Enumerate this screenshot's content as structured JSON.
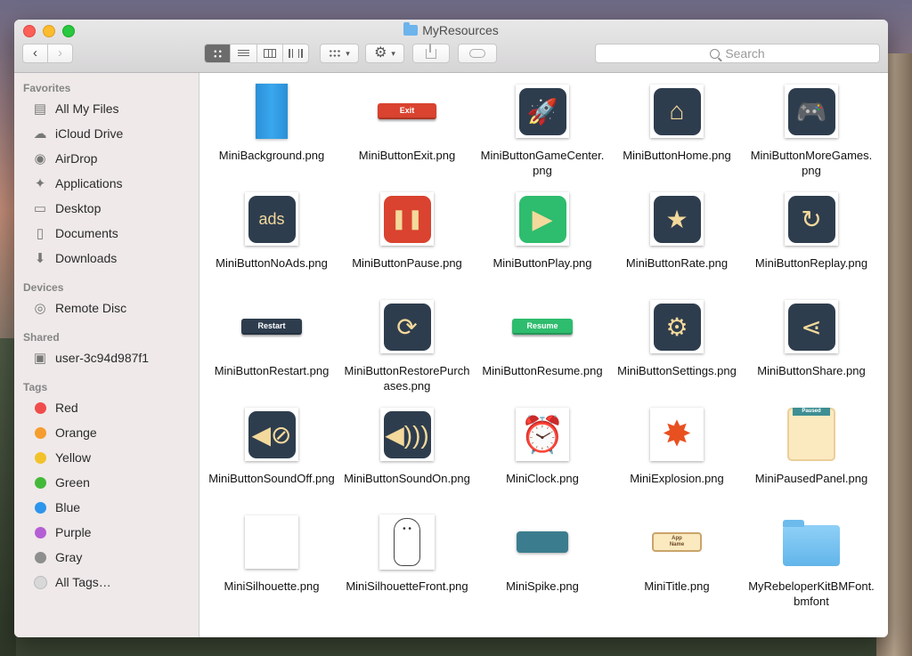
{
  "window": {
    "title": "MyResources"
  },
  "toolbar": {
    "search_placeholder": "Search",
    "back_icon": "chevron-left",
    "forward_icon": "chevron-right",
    "view_modes": [
      "icon",
      "list",
      "column",
      "cover-flow"
    ],
    "gear_glyph": "⚙",
    "chevron_glyph": "▾"
  },
  "sidebar": {
    "favorites_title": "Favorites",
    "favorites": [
      {
        "label": "All My Files",
        "icon": "all-files-icon",
        "glyph": "▤"
      },
      {
        "label": "iCloud Drive",
        "icon": "cloud-icon",
        "glyph": "☁"
      },
      {
        "label": "AirDrop",
        "icon": "airdrop-icon",
        "glyph": "◉"
      },
      {
        "label": "Applications",
        "icon": "applications-icon",
        "glyph": "✦"
      },
      {
        "label": "Desktop",
        "icon": "desktop-icon",
        "glyph": "▭"
      },
      {
        "label": "Documents",
        "icon": "documents-icon",
        "glyph": "▯"
      },
      {
        "label": "Downloads",
        "icon": "downloads-icon",
        "glyph": "⬇"
      }
    ],
    "devices_title": "Devices",
    "devices": [
      {
        "label": "Remote Disc",
        "icon": "disc-icon",
        "glyph": "◎"
      }
    ],
    "shared_title": "Shared",
    "shared": [
      {
        "label": "user-3c94d987f1",
        "icon": "computer-icon",
        "glyph": "▣"
      }
    ],
    "tags_title": "Tags",
    "tags": [
      {
        "label": "Red",
        "color": "#f14c4c"
      },
      {
        "label": "Orange",
        "color": "#f59d2e"
      },
      {
        "label": "Yellow",
        "color": "#f2c22b"
      },
      {
        "label": "Green",
        "color": "#43b93a"
      },
      {
        "label": "Blue",
        "color": "#2d95ec"
      },
      {
        "label": "Purple",
        "color": "#b460d4"
      },
      {
        "label": "Gray",
        "color": "#8e8e8e"
      },
      {
        "label": "All Tags…",
        "color": "#d8d8d8"
      }
    ]
  },
  "files": [
    {
      "name": "MiniBackground.png",
      "icon": "background-icon"
    },
    {
      "name": "MiniButtonExit.png",
      "icon": "exit-button-icon",
      "text": "Exit"
    },
    {
      "name": "MiniButtonGameCenter.png",
      "icon": "rocket-icon",
      "glyph": "🚀"
    },
    {
      "name": "MiniButtonHome.png",
      "icon": "home-icon",
      "glyph": "⌂"
    },
    {
      "name": "MiniButtonMoreGames.png",
      "icon": "gamepad-icon",
      "glyph": "🎮"
    },
    {
      "name": "MiniButtonNoAds.png",
      "icon": "no-ads-icon",
      "text": "ads"
    },
    {
      "name": "MiniButtonPause.png",
      "icon": "pause-icon",
      "glyph": "❚❚"
    },
    {
      "name": "MiniButtonPlay.png",
      "icon": "play-icon",
      "glyph": "▶"
    },
    {
      "name": "MiniButtonRate.png",
      "icon": "star-icon",
      "glyph": "★"
    },
    {
      "name": "MiniButtonReplay.png",
      "icon": "replay-icon",
      "glyph": "↻"
    },
    {
      "name": "MiniButtonRestart.png",
      "icon": "restart-button-icon",
      "text": "Restart"
    },
    {
      "name": "MiniButtonRestorePurchases.png",
      "icon": "restore-icon",
      "glyph": "⟳"
    },
    {
      "name": "MiniButtonResume.png",
      "icon": "resume-button-icon",
      "text": "Resume"
    },
    {
      "name": "MiniButtonSettings.png",
      "icon": "settings-gears-icon",
      "glyph": "⚙"
    },
    {
      "name": "MiniButtonShare.png",
      "icon": "share-icon",
      "glyph": "⋖"
    },
    {
      "name": "MiniButtonSoundOff.png",
      "icon": "sound-off-icon",
      "glyph": "◀⊘"
    },
    {
      "name": "MiniButtonSoundOn.png",
      "icon": "sound-on-icon",
      "glyph": "◀)))"
    },
    {
      "name": "MiniClock.png",
      "icon": "alarm-clock-icon",
      "glyph": "⏰"
    },
    {
      "name": "MiniExplosion.png",
      "icon": "explosion-icon",
      "glyph": "✸"
    },
    {
      "name": "MiniPausedPanel.png",
      "icon": "paused-panel-icon",
      "text": "Paused"
    },
    {
      "name": "MiniSilhouette.png",
      "icon": "silhouette-icon"
    },
    {
      "name": "MiniSilhouetteFront.png",
      "icon": "silhouette-front-icon"
    },
    {
      "name": "MiniSpike.png",
      "icon": "spike-icon"
    },
    {
      "name": "MiniTitle.png",
      "icon": "title-icon",
      "text": "App Name"
    },
    {
      "name": "MyRebeloperKitBMFont.bmfont",
      "icon": "folder-icon"
    }
  ]
}
